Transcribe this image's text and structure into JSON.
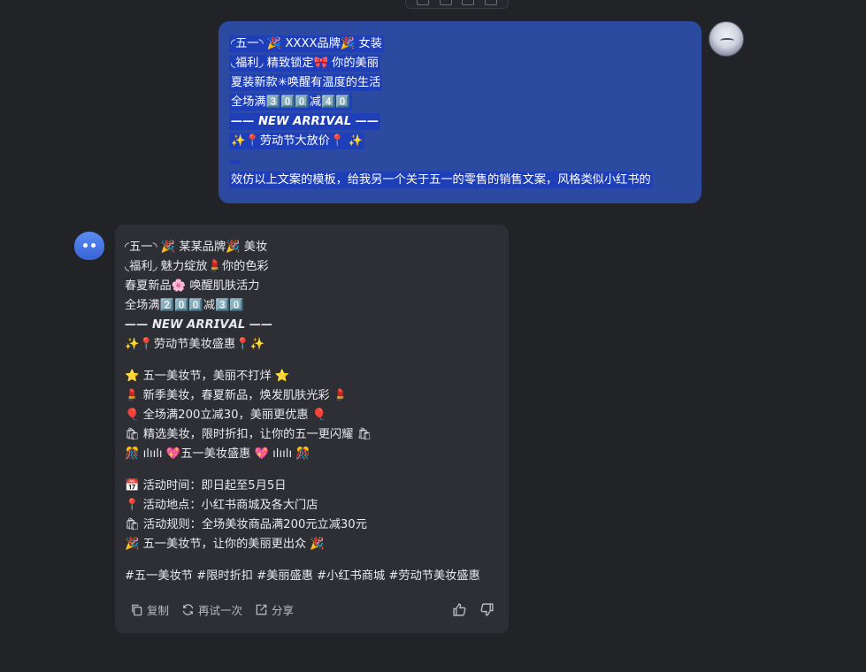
{
  "user_message": {
    "lines": [
      "◜五一◝ 🎉 XXXX品牌🎉 女装",
      "◟福利◞ 精致锁定🎀 你的美丽",
      "夏装新款✳唤醒有温度的生活",
      "全场满3️⃣0️⃣0️⃣减4️⃣0️⃣",
      "—— 𝙉𝙀𝙒 𝘼𝙍𝙍𝙄𝙑𝘼𝙇 ——",
      "✨📍劳动节大放价📍 ✨",
      " ",
      "效仿以上文案的模板，给我另一个关于五一的零售的销售文案，风格类似小红书的"
    ]
  },
  "assistant_message": {
    "block1": [
      "◜五一◝ 🎉 某某品牌🎉 美妆",
      "◟福利◞ 魅力绽放💄你的色彩",
      "春夏新品🌸 唤醒肌肤活力",
      "全场满2️⃣0️⃣0️⃣减3️⃣0️⃣",
      "—— 𝙉𝙀𝙒 𝘼𝙍𝙍𝙄𝙑𝘼𝙇 ——",
      "✨📍劳动节美妆盛惠📍✨"
    ],
    "block2": [
      "⭐ 五一美妆节，美丽不打烊 ⭐",
      "💄 新季美妆，春夏新品，焕发肌肤光彩 💄",
      "🎈 全场满200立减30，美丽更优惠 🎈",
      "🛍 精选美妆，限时折扣，让你的五一更闪耀 🛍",
      "🎊 ılıılı 💖五一美妆盛惠 💖 ılıılı 🎊"
    ],
    "block3": [
      "📅 活动时间：即日起至5月5日",
      "📍 活动地点：小红书商城及各大门店",
      "🛍 活动规则：全场美妆商品满200元立减30元",
      "🎉 五一美妆节，让你的美丽更出众 🎉"
    ],
    "hashtags": "#五一美妆节 #限时折扣 #美丽盛惠 #小红书商城 #劳动节美妆盛惠"
  },
  "actions": {
    "copy": "复制",
    "retry": "再试一次",
    "share": "分享"
  },
  "icons": {
    "copy": "copy-icon",
    "retry": "refresh-icon",
    "share": "share-icon",
    "like": "thumbs-up-icon",
    "dislike": "thumbs-down-icon"
  },
  "colors": {
    "background": "#222327",
    "user_bubble": "#2b4aa0",
    "selection": "#1e3fb8",
    "assistant_bubble": "#2e2f35"
  }
}
